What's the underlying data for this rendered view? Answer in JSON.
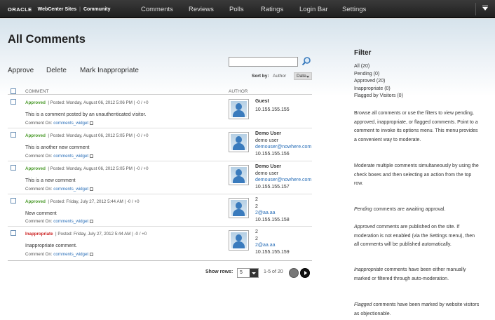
{
  "brand": {
    "oracle": "ORACLE",
    "product": "WebCenter Sites",
    "section": "Community"
  },
  "nav": [
    "Comments",
    "Reviews",
    "Polls",
    "Ratings",
    "Login Bar",
    "Settings"
  ],
  "page_title": "All Comments",
  "actions": [
    "Approve",
    "Delete",
    "Mark Inappropriate"
  ],
  "search": {
    "value": "",
    "placeholder": ""
  },
  "sort": {
    "label": "Sort by:",
    "author": "Author",
    "date": "Date"
  },
  "columns": {
    "comment": "COMMENT",
    "author": "AUTHOR"
  },
  "comments": [
    {
      "status": "Approved",
      "meta": "| Posted: Monday, August 06, 2012 5:06 PM  | -0 / +0",
      "text": "This is a comment posted by an unauthenticated visitor.",
      "comment_on_label": "Comment On:",
      "widget": "comments_widget",
      "author_name": "Guest",
      "author_line2": "",
      "author_email": "",
      "ip": "10.155.155.155"
    },
    {
      "status": "Approved",
      "meta": "| Posted: Monday, August 06, 2012 5:05 PM  | -0 / +0",
      "text": "This is another new comment",
      "comment_on_label": "Comment On:",
      "widget": "comments_widget",
      "author_name": "Demo User",
      "author_line2": "demo user",
      "author_email": "demouser@nowhere.com",
      "ip": "10.155.155.156"
    },
    {
      "status": "Approved",
      "meta": "| Posted: Monday, August 06, 2012 5:05 PM  | -0 / +0",
      "text": "This is a new comment",
      "comment_on_label": "Comment On:",
      "widget": "comments_widget",
      "author_name": "Demo User",
      "author_line2": "demo user",
      "author_email": "demouser@nowhere.com",
      "ip": "10.155.155.157"
    },
    {
      "status": "Approved",
      "meta": "| Posted: Friday, July 27, 2012 5:44 AM  | -0 / +0",
      "text": "New comment",
      "comment_on_label": "Comment On:",
      "widget": "comments_widget",
      "author_name": "2",
      "author_line2": "2",
      "author_email": "2@aa.aa",
      "ip": "10.155.155.158"
    },
    {
      "status": "Inappropriate",
      "meta": "| Posted: Friday, July 27, 2012 5:44 AM  | -0 / +0",
      "text": "Inappropriate comment.",
      "comment_on_label": "Comment On:",
      "widget": "comments_widget",
      "author_name": "2",
      "author_line2": "2",
      "author_email": "2@aa.aa",
      "ip": "10.155.155.159"
    }
  ],
  "pager": {
    "label": "Show rows:",
    "rows": "5",
    "range": "1-5 of 20"
  },
  "filter": {
    "title": "Filter",
    "items": [
      "All (20)",
      "Pending (0)",
      "Approved (20)",
      "Inappropriate (0)",
      "Flagged by Visitors (0)"
    ],
    "help1": "Browse all comments or use the filters to view pending, approved, inappropriate, or flagged comments. Point to a comment to invoke its options menu. This menu provides a convenient way to moderate.",
    "help2": "Moderate multiple comments simultaneously by using the check boxes and then selecting an action from the top row.",
    "help3_term": "Pending",
    "help3": " comments are awaiting approval.",
    "help4_term": "Approved",
    "help4": " comments are published on the site. If moderation is not enabled (via the Settings menu), then all comments will be published automatically.",
    "help5_term": "Inappropriate",
    "help5": " comments have been either manually marked or filtered through auto-moderation.",
    "help6_term": "Flagged",
    "help6": " comments have been marked by website visitors as objectionable."
  },
  "colors": {
    "approved": "#4a9a2a",
    "inappropriate": "#cc2222",
    "link": "#2a6fb8"
  }
}
